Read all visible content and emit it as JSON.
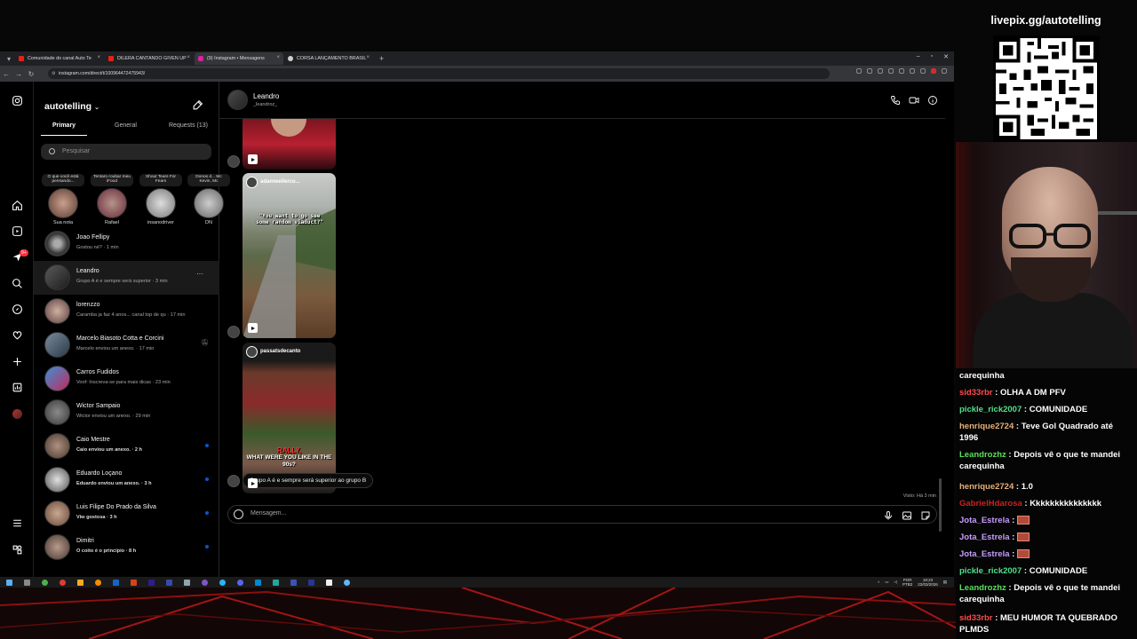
{
  "stream": {
    "livepix_text": "livepix.gg/autotelling"
  },
  "browser": {
    "tabs": [
      {
        "label": "Comunidade do canal Auto Te",
        "color": "#e62117",
        "active": false
      },
      {
        "label": "DILERA CANTANDO GIVEN UP",
        "color": "#e62117",
        "active": false
      },
      {
        "label": "(9) Instagram • Mensagens",
        "color": "#d6249f",
        "active": true
      },
      {
        "label": "CORSA LANÇAMENTO BRASIL",
        "color": "#cfcfcf",
        "active": false
      }
    ],
    "url": "instagram.com/direct/t/100964472475943/"
  },
  "instagram": {
    "account": "autotelling",
    "notification_count": "9+",
    "inbox_tabs": {
      "primary": "Primary",
      "general": "General",
      "requests": "Requests (13)"
    },
    "search_placeholder": "Pesquisar",
    "notes": [
      {
        "text": "O que você está pensando...",
        "name": "Sua nota"
      },
      {
        "text": "Tentaro roubar meu iFood",
        "name": "Rafael"
      },
      {
        "text": "Shout Tears For Fears",
        "name": "insanodriver"
      },
      {
        "text": "Donos d... Mc Kevin, Mc",
        "name": "DN"
      }
    ],
    "conversations": [
      {
        "name": "Joao Fellipy",
        "preview": "Gostou né? · 1 min",
        "unread": false
      },
      {
        "name": "Leandro",
        "preview": "Grupo A é e sempre será superior · 3 min",
        "unread": false
      },
      {
        "name": "lorenzzo",
        "preview": "Caramba ja faz 4 anos... canal top de qu · 17 min",
        "unread": false
      },
      {
        "name": "Marcelo Biasoto Cotta e Corcini",
        "preview": "Marcelo enviou um anexo. · 17 min",
        "unread": false
      },
      {
        "name": "Carros Fudidos",
        "preview": "Voof: Inscreva-se para mais dicas · 23 min",
        "unread": false
      },
      {
        "name": "Wictor Sampaio",
        "preview": "Wictor enviou um anexo. · 29 min",
        "unread": false
      },
      {
        "name": "Caio Mestre",
        "preview": "Caio enviou um anexo. · 2 h",
        "unread": true
      },
      {
        "name": "Eduardo Loçano",
        "preview": "Eduardo enviou um anexo. · 3 h",
        "unread": true
      },
      {
        "name": "Luis Filipe Do Prado da Silva",
        "preview": "Viw gostosa · 3 h",
        "unread": true
      },
      {
        "name": "Dimitri",
        "preview": "O coito é o princípio · 8 h",
        "unread": true
      }
    ],
    "chat": {
      "name": "Leandro",
      "username": "_leandroz_",
      "reels": [
        {
          "account": "",
          "caption": ""
        },
        {
          "account": "adamwellerco...",
          "caption": "\"You want to go see some random viaduct?\""
        },
        {
          "account": "passatsdecanto",
          "caption_top": "RALLY,",
          "caption_bottom": "WHAT WERE YOU LIKE IN THE 90s?"
        }
      ],
      "last_message": "Grupo A é e sempre será superior ao grupo B",
      "seen": "Visto: Há 3 min",
      "composer_placeholder": "Mensagem..."
    }
  },
  "taskbar": {
    "lang": "POR",
    "layout": "PTB2",
    "time": "18:23",
    "date": "22/03/2026"
  },
  "chatlog": [
    {
      "user": "",
      "text": "carequinha",
      "color": "#ffffff"
    },
    {
      "user": "sid33rbr",
      "text": ": OLHA A DM PFV",
      "color": "#ff4a4a"
    },
    {
      "user": "pickle_rick2007",
      "text": ": COMUNIDADE",
      "color": "#4fe08a"
    },
    {
      "user": "henrique2724",
      "text": ": Teve Gol Quadrado até 1996",
      "color": "#e6b07a"
    },
    {
      "user": "Leandrozhz",
      "text": ": Depois vê o que te mandei carequinha",
      "color": "#59e05a"
    },
    {
      "user": "henrique2724",
      "text": ": 1.0",
      "color": "#e6b07a"
    },
    {
      "user": "GabrielHdarosa",
      "text": ": Kkkkkkkkkkkkkkk",
      "color": "#cc2020"
    },
    {
      "user": "Jota_Estrela",
      "text": ":",
      "color": "#c79cff"
    },
    {
      "user": "Jota_Estrela",
      "text": ":",
      "color": "#c79cff"
    },
    {
      "user": "Jota_Estrela",
      "text": ":",
      "color": "#c79cff"
    },
    {
      "user": "pickle_rick2007",
      "text": ": COMUNIDADE",
      "color": "#4fe08a"
    },
    {
      "user": "Leandrozhz",
      "text": ": Depois vê o que te mandei carequinha",
      "color": "#59e05a"
    },
    {
      "user": "sid33rbr",
      "text": ": MEU HUMOR TA QUEBRADO PLMDS",
      "color": "#ff4a4a"
    }
  ]
}
